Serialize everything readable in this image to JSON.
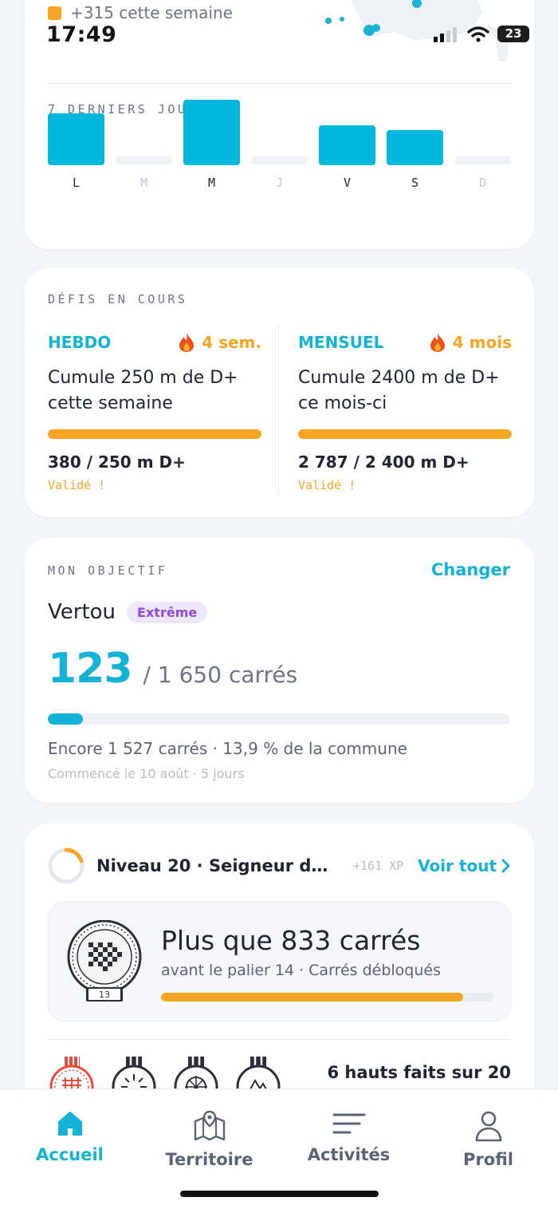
{
  "status_bar": {
    "week_gain": "+315 cette semaine",
    "time": "17:49",
    "battery": "23",
    "accent": "#f5a623"
  },
  "week_chart": {
    "title": "7 DERNIERS JOURS",
    "chart_data": {
      "type": "bar",
      "categories": [
        "L",
        "M",
        "M",
        "J",
        "V",
        "S",
        "D"
      ],
      "values": [
        65,
        0,
        82,
        0,
        50,
        44,
        0
      ],
      "active": [
        true,
        false,
        true,
        false,
        true,
        true,
        false
      ],
      "colors": {
        "bar": "#00b8dc",
        "empty": "#eef1f5",
        "label": "#1d2433",
        "label_muted": "#c2c8d2"
      }
    }
  },
  "challenges": {
    "title": "DÉFIS EN COURS",
    "items": [
      {
        "kind": "HEBDO",
        "streak": "4 sem.",
        "text": "Cumule 250 m de D+ cette semaine",
        "amount": "380 / 250 m D+",
        "status": "Validé !",
        "progress": 1.0
      },
      {
        "kind": "MENSUEL",
        "streak": "4 mois",
        "text": "Cumule 2400 m de D+ ce mois-ci",
        "amount": "2 787 / 2 400 m D+",
        "status": "Validé !",
        "progress": 1.0
      }
    ]
  },
  "objective": {
    "title": "MON OBJECTIF",
    "change_label": "Changer",
    "name": "Vertou",
    "badge": "Extrême",
    "count": "123",
    "total": "/ 1 650 carrés",
    "progress": 0.075,
    "remaining": "Encore 1 527 carrés · 13,9 % de la commune",
    "started": "Commencé le 10 août · 5 jours"
  },
  "level": {
    "text": "Niveau 20 · Seigneur du...",
    "xp": "+161 XP",
    "link": "Voir tout",
    "ring_progress": 0.2,
    "milestone": {
      "badge_number": "13",
      "title": "Plus que 833 carrés",
      "subtitle": "avant le palier 14 · Carrés débloqués",
      "progress": 0.91
    },
    "feats": "6 hauts faits sur 20"
  },
  "tabbar": {
    "tabs": [
      {
        "label": "Accueil",
        "icon": "home-icon",
        "active": true
      },
      {
        "label": "Territoire",
        "icon": "map-icon",
        "active": false
      },
      {
        "label": "Activités",
        "icon": "list-icon",
        "active": false
      },
      {
        "label": "Profil",
        "icon": "profile-icon",
        "active": false
      }
    ]
  }
}
